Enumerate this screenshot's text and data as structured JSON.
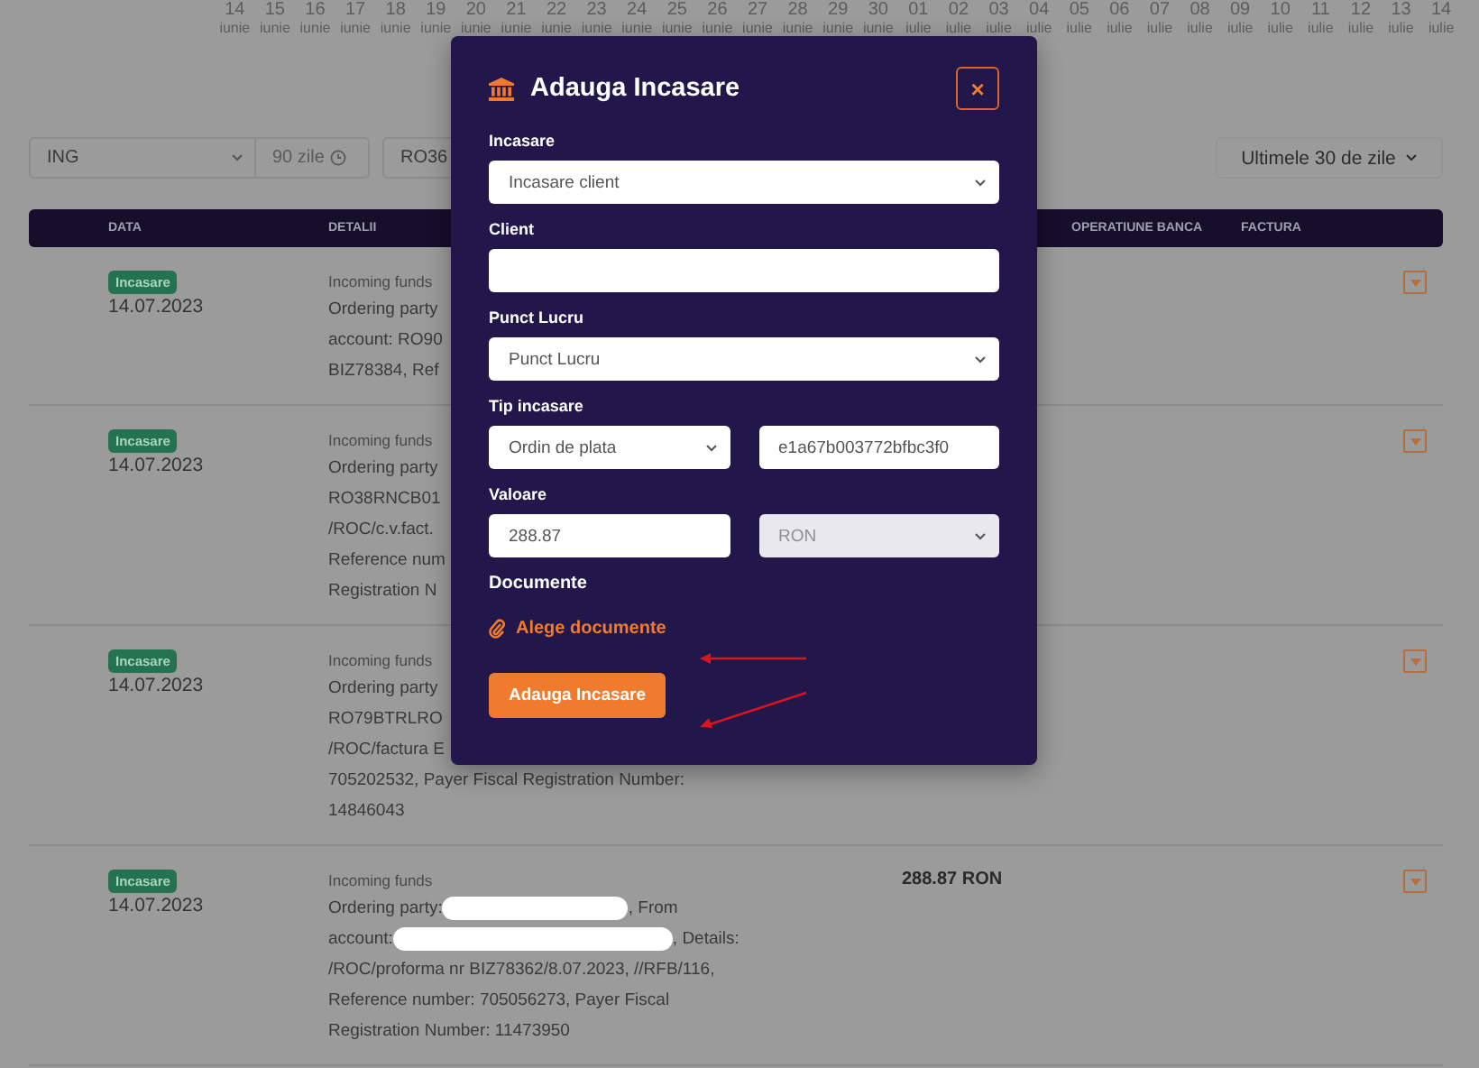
{
  "date_strip": [
    {
      "day": "14",
      "month": "iunie"
    },
    {
      "day": "15",
      "month": "iunie"
    },
    {
      "day": "16",
      "month": "iunie"
    },
    {
      "day": "17",
      "month": "iunie"
    },
    {
      "day": "18",
      "month": "iunie"
    },
    {
      "day": "19",
      "month": "iunie"
    },
    {
      "day": "20",
      "month": "iunie"
    },
    {
      "day": "21",
      "month": "iunie"
    },
    {
      "day": "22",
      "month": "iunie"
    },
    {
      "day": "23",
      "month": "iunie"
    },
    {
      "day": "24",
      "month": "iunie"
    },
    {
      "day": "25",
      "month": "iunie"
    },
    {
      "day": "26",
      "month": "iunie"
    },
    {
      "day": "27",
      "month": "iunie"
    },
    {
      "day": "28",
      "month": "iunie"
    },
    {
      "day": "29",
      "month": "iunie"
    },
    {
      "day": "30",
      "month": "iunie"
    },
    {
      "day": "01",
      "month": "iulie"
    },
    {
      "day": "02",
      "month": "iulie"
    },
    {
      "day": "03",
      "month": "iulie"
    },
    {
      "day": "04",
      "month": "iulie"
    },
    {
      "day": "05",
      "month": "iulie"
    },
    {
      "day": "06",
      "month": "iulie"
    },
    {
      "day": "07",
      "month": "iulie"
    },
    {
      "day": "08",
      "month": "iulie"
    },
    {
      "day": "09",
      "month": "iulie"
    },
    {
      "day": "10",
      "month": "iulie"
    },
    {
      "day": "11",
      "month": "iulie"
    },
    {
      "day": "12",
      "month": "iulie"
    },
    {
      "day": "13",
      "month": "iulie"
    },
    {
      "day": "14",
      "month": "iulie"
    }
  ],
  "filters": {
    "bank": "ING",
    "period": "90 zile",
    "account": "RO36",
    "range": "Ultimele 30 de zile"
  },
  "table": {
    "columns": [
      "DATA",
      "DETALII",
      "OPERATIUNE BANCA",
      "FACTURA"
    ],
    "rows": [
      {
        "badge": "Incasare",
        "date": "14.07.2023",
        "details_title": "Incoming funds",
        "details": [
          {
            "kind": "text",
            "text": "Ordering party"
          },
          {
            "kind": "text",
            "text": "account: RO90"
          },
          {
            "kind": "text",
            "text": "BIZ78384, Ref"
          }
        ]
      },
      {
        "badge": "Incasare",
        "date": "14.07.2023",
        "details_title": "Incoming funds",
        "details": [
          {
            "kind": "text",
            "text": "Ordering party"
          },
          {
            "kind": "text",
            "text": "RO38RNCB01"
          },
          {
            "kind": "text",
            "text": "/ROC/c.v.fact."
          },
          {
            "kind": "text",
            "text": "Reference num"
          },
          {
            "kind": "text",
            "text": "Registration N"
          }
        ]
      },
      {
        "badge": "Incasare",
        "date": "14.07.2023",
        "details_title": "Incoming funds",
        "details": [
          {
            "kind": "text",
            "text": "Ordering party"
          },
          {
            "kind": "text",
            "text": "RO79BTRLRO"
          },
          {
            "kind": "text",
            "text": "/ROC/factura E"
          },
          {
            "kind": "text",
            "text": "705202532, Payer Fiscal Registration Number:"
          },
          {
            "kind": "text",
            "text": "14846043"
          }
        ]
      },
      {
        "badge": "Incasare",
        "date": "14.07.2023",
        "details_title": "Incoming funds",
        "amount": "288.87 RON",
        "details": [
          {
            "kind": "redacted",
            "before": "Ordering party:",
            "after": ", From",
            "wide": false
          },
          {
            "kind": "redacted",
            "before": "account:",
            "after": ", Details:",
            "wide": true
          },
          {
            "kind": "text",
            "text": "/ROC/proforma nr BIZ78362/8.07.2023, //RFB/116,"
          },
          {
            "kind": "text",
            "text": "Reference number: 705056273, Payer Fiscal"
          },
          {
            "kind": "text",
            "text": "Registration Number: 11473950"
          }
        ]
      }
    ]
  },
  "modal": {
    "title": "Adauga Incasare",
    "close": "×",
    "fields": [
      {
        "label": "Incasare",
        "inputs": [
          {
            "kind": "select",
            "value": "Incasare client",
            "disabled": false
          }
        ]
      },
      {
        "label": "Client",
        "inputs": [
          {
            "kind": "input",
            "disabled": false
          }
        ]
      },
      {
        "label": "Punct Lucru",
        "inputs": [
          {
            "kind": "select",
            "value": "Punct Lucru",
            "disabled": false
          }
        ]
      },
      {
        "label": "Tip incasare",
        "inputs": [
          {
            "kind": "select",
            "value": "Ordin de plata",
            "disabled": false
          },
          {
            "kind": "input",
            "value": "e1a67b003772bfbc3f0",
            "disabled": false
          }
        ]
      },
      {
        "label": "Valoare",
        "inputs": [
          {
            "kind": "input",
            "value": "288.87",
            "disabled": false
          },
          {
            "kind": "select",
            "value": "RON",
            "disabled": true
          }
        ]
      }
    ],
    "documents_label": "Documente",
    "documents_link": "Alege documente",
    "submit": "Adauga Incasare"
  }
}
